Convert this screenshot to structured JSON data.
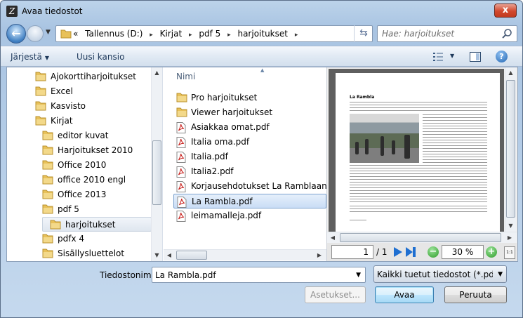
{
  "window": {
    "title": "Avaa tiedostot",
    "close_label": "x"
  },
  "address": {
    "crumbs": [
      "Tallennus (D:)",
      "Kirjat",
      "pdf 5",
      "harjoitukset"
    ],
    "overflow": "«",
    "separator": "▸"
  },
  "search": {
    "placeholder": "Hae: harjoitukset"
  },
  "toolbar": {
    "organize_label": "Järjestä",
    "new_folder_label": "Uusi kansio",
    "help_label": "?"
  },
  "nav": {
    "items": [
      {
        "label": "Ajokorttiharjoitukset",
        "indent": 0
      },
      {
        "label": "Excel",
        "indent": 0
      },
      {
        "label": "Kasvisto",
        "indent": 0
      },
      {
        "label": "Kirjat",
        "indent": 0
      },
      {
        "label": "editor kuvat",
        "indent": 1
      },
      {
        "label": "Harjoitukset 2010",
        "indent": 1
      },
      {
        "label": "Office 2010",
        "indent": 1
      },
      {
        "label": "office 2010 engl",
        "indent": 1
      },
      {
        "label": "Office 2013",
        "indent": 1
      },
      {
        "label": "pdf 5",
        "indent": 1
      },
      {
        "label": "harjoitukset",
        "indent": 2,
        "selected": true
      },
      {
        "label": "pdfx 4",
        "indent": 1
      },
      {
        "label": "Sisällysluettelot",
        "indent": 1
      }
    ]
  },
  "files": {
    "column_name": "Nimi",
    "items": [
      {
        "label": "Pro harjoitukset",
        "type": "folder"
      },
      {
        "label": "Viewer harjoitukset",
        "type": "folder"
      },
      {
        "label": "Asiakkaa omat.pdf",
        "type": "pdf"
      },
      {
        "label": "Italia oma.pdf",
        "type": "pdf"
      },
      {
        "label": "Italia.pdf",
        "type": "pdf"
      },
      {
        "label": "Italia2.pdf",
        "type": "pdf"
      },
      {
        "label": "Korjausehdotukset La Ramblaan.pdf",
        "type": "pdf"
      },
      {
        "label": "La Rambla.pdf",
        "type": "pdf",
        "selected": true
      },
      {
        "label": "leimamalleja.pdf",
        "type": "pdf"
      }
    ]
  },
  "preview": {
    "doc_title": "La Rambla",
    "current_page": "1",
    "page_count": "/ 1",
    "zoom": "30 %",
    "zoom_out_label": "−",
    "zoom_in_label": "+",
    "fit_label": "1:1"
  },
  "bottom": {
    "filename_label": "Tiedostonimi:",
    "filename_value": "La Rambla.pdf",
    "filetype_value": "Kaikki tuetut tiedostot (*.pdf;*.x",
    "settings_label": "Asetukset...",
    "open_label": "Avaa",
    "cancel_label": "Peruuta"
  },
  "colors": {
    "folder": "#e8c15a",
    "pdf_red": "#c8211d",
    "accent": "#3c7fb1"
  }
}
